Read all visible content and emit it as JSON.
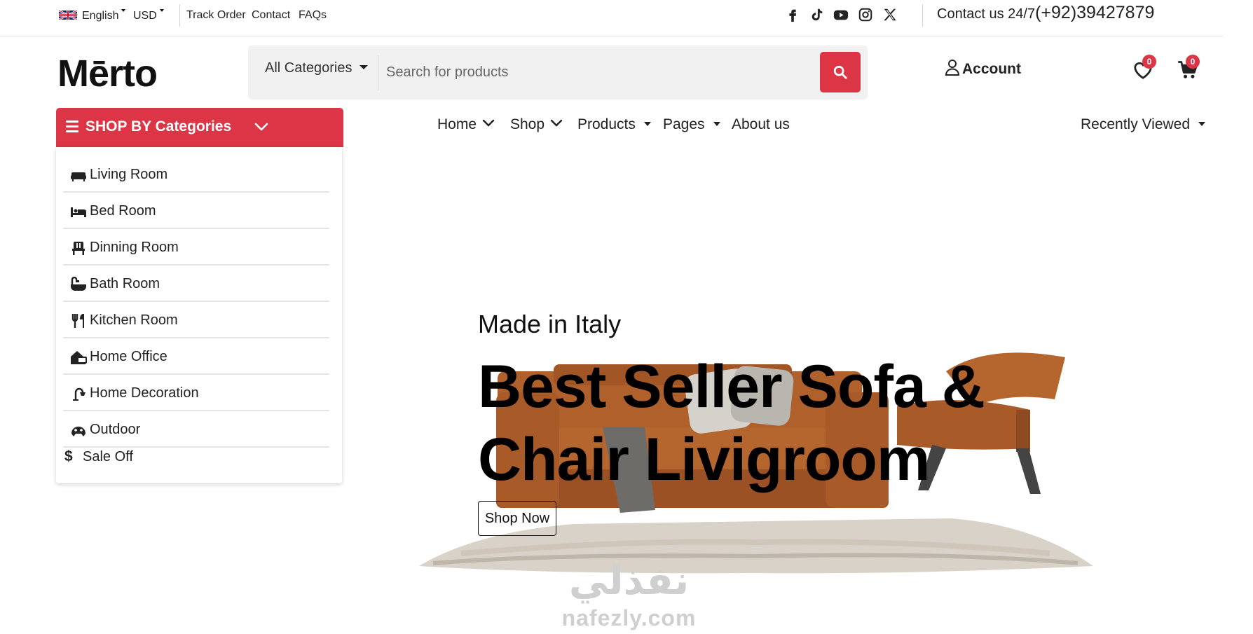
{
  "topbar": {
    "language": "English",
    "currency": "USD",
    "links": [
      "Track Order",
      "Contact",
      "FAQs"
    ],
    "social_icons": [
      "facebook-icon",
      "tiktok-icon",
      "youtube-icon",
      "instagram-icon",
      "x-icon"
    ],
    "contact_label": "Contact us 24/7",
    "phone": "(+92)39427879"
  },
  "header": {
    "logo": "Mērto",
    "category_select": "All Categories",
    "search_placeholder": "Search for products",
    "account_label": "Account",
    "wishlist_count": "0",
    "cart_count": "0"
  },
  "categories": {
    "title": "SHOP BY Categories",
    "items": [
      {
        "label": "Living Room",
        "icon": "sofa-icon"
      },
      {
        "label": "Bed Room",
        "icon": "bed-icon"
      },
      {
        "label": "Dinning Room",
        "icon": "chair-icon"
      },
      {
        "label": "Bath Room",
        "icon": "bath-icon"
      },
      {
        "label": "Kitchen Room",
        "icon": "utensils-icon"
      },
      {
        "label": "Home Office",
        "icon": "home-office-icon"
      },
      {
        "label": "Home Decoration",
        "icon": "lamp-icon"
      },
      {
        "label": "Outdoor",
        "icon": "outdoor-icon"
      },
      {
        "label": "Sale Off",
        "icon": "dollar-icon"
      }
    ]
  },
  "nav": {
    "home": "Home",
    "shop": "Shop",
    "products": "Products",
    "pages": "Pages",
    "about": "About us",
    "recently_viewed": "Recently Viewed"
  },
  "hero": {
    "subtitle": "Made in Italy",
    "title": "Best Seller Sofa & Chair Livigroom",
    "cta": "Shop Now"
  },
  "watermark": {
    "arabic": "نفذلي",
    "latin": "nafezly.com"
  },
  "colors": {
    "accent": "#dc3545",
    "text": "#111111",
    "leather": "#b5652e"
  }
}
